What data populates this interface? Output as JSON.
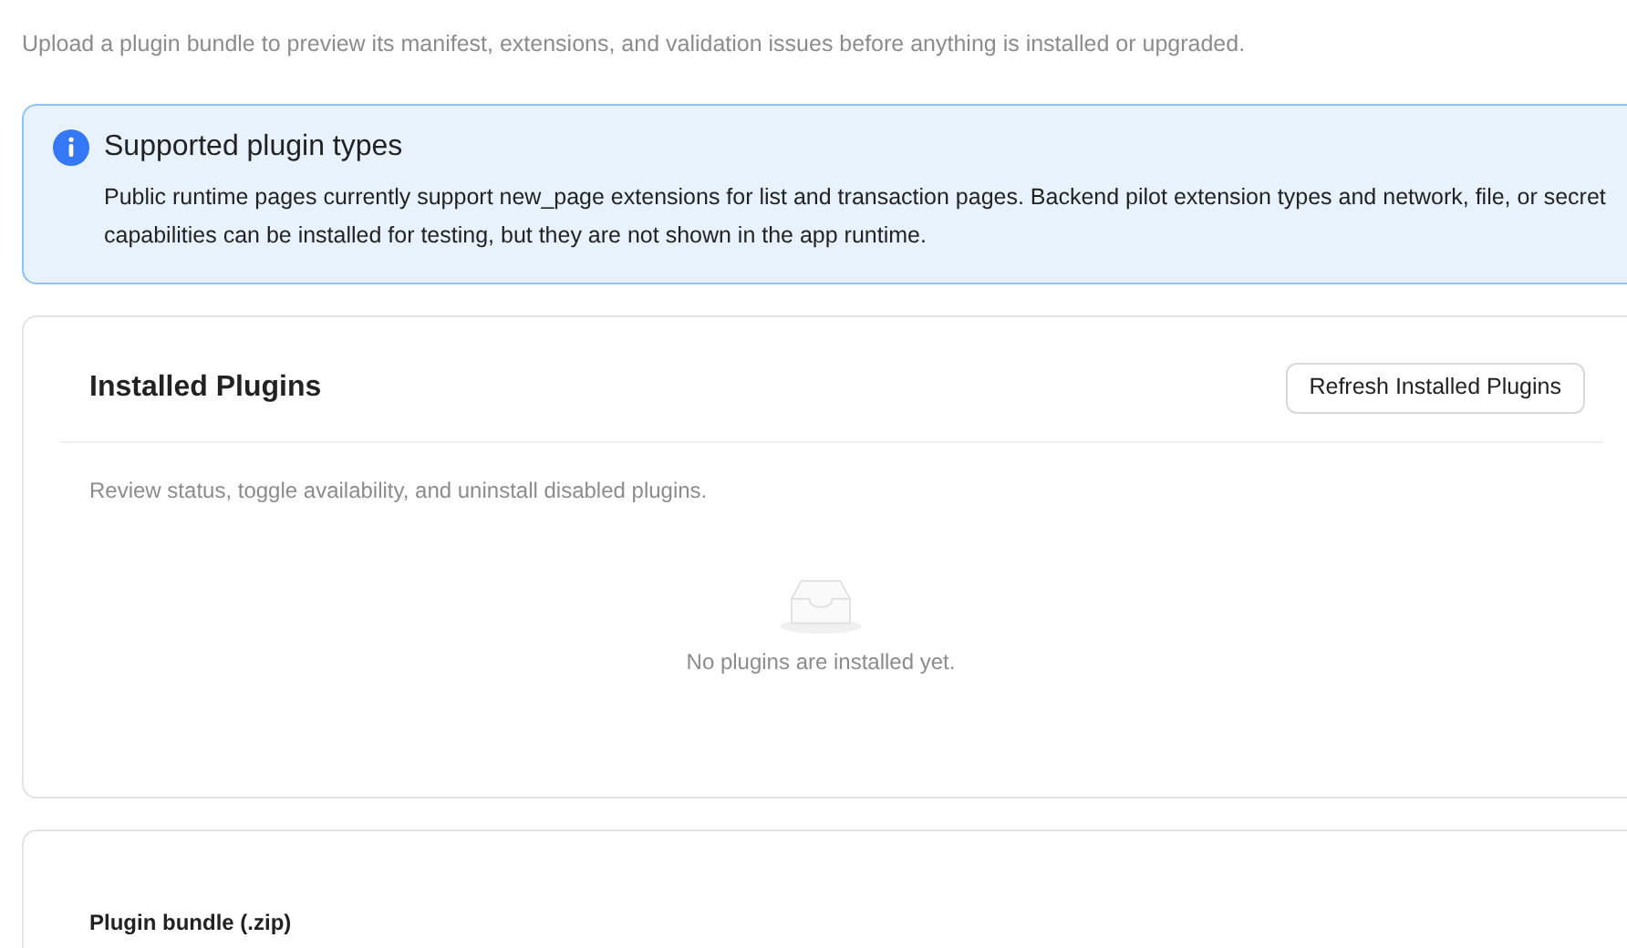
{
  "page": {
    "subtitle": "Upload a plugin bundle to preview its manifest, extensions, and validation issues before anything is installed or upgraded."
  },
  "alert": {
    "title": "Supported plugin types",
    "body": "Public runtime pages currently support new_page extensions for list and transaction pages. Backend pilot extension types and network, file, or secret capabilities can be installed for testing, but they are not shown in the app runtime."
  },
  "installed_plugins": {
    "title": "Installed Plugins",
    "refresh_button": "Refresh Installed Plugins",
    "description": "Review status, toggle availability, and uninstall disabled plugins.",
    "empty_text": "No plugins are installed yet."
  },
  "upload": {
    "label": "Plugin bundle (.zip)"
  }
}
